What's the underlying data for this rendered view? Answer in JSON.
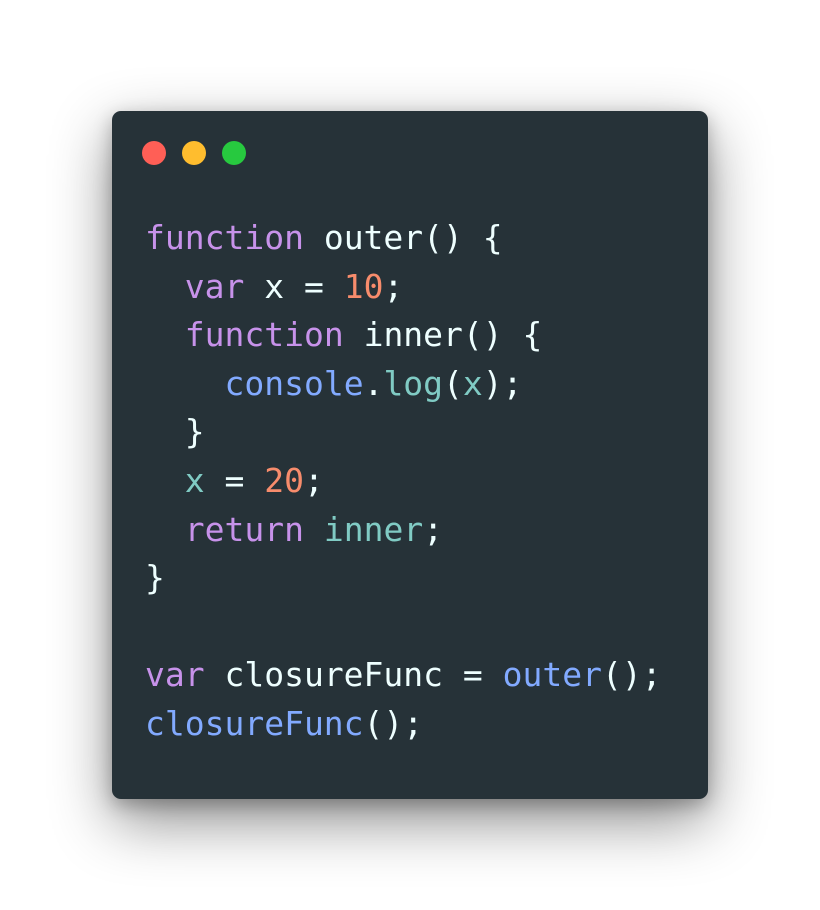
{
  "window": {
    "traffic_lights": [
      {
        "name": "close",
        "color": "#ff5f56"
      },
      {
        "name": "minimize",
        "color": "#ffbd2e"
      },
      {
        "name": "maximize",
        "color": "#27c93f"
      }
    ]
  },
  "theme": {
    "background": "#263238",
    "default": "#eeffff",
    "keyword": "#c792ea",
    "number": "#f78c6c",
    "function": "#82aaff",
    "variable": "#89ddff",
    "identifier": "#80cbc4"
  },
  "code": {
    "language": "javascript",
    "lines": [
      [
        {
          "t": "function",
          "k": "keyword"
        },
        {
          "t": " outer() {",
          "k": "default"
        }
      ],
      [
        {
          "t": "  ",
          "k": "default"
        },
        {
          "t": "var",
          "k": "keyword"
        },
        {
          "t": " x = ",
          "k": "default"
        },
        {
          "t": "10",
          "k": "number"
        },
        {
          "t": ";",
          "k": "default"
        }
      ],
      [
        {
          "t": "  ",
          "k": "default"
        },
        {
          "t": "function",
          "k": "keyword"
        },
        {
          "t": " inner() {",
          "k": "default"
        }
      ],
      [
        {
          "t": "    ",
          "k": "default"
        },
        {
          "t": "console",
          "k": "function"
        },
        {
          "t": ".",
          "k": "default"
        },
        {
          "t": "log",
          "k": "identifier"
        },
        {
          "t": "(",
          "k": "default"
        },
        {
          "t": "x",
          "k": "identifier"
        },
        {
          "t": ");",
          "k": "default"
        }
      ],
      [
        {
          "t": "  }",
          "k": "default"
        }
      ],
      [
        {
          "t": "  ",
          "k": "default"
        },
        {
          "t": "x",
          "k": "identifier"
        },
        {
          "t": " = ",
          "k": "default"
        },
        {
          "t": "20",
          "k": "number"
        },
        {
          "t": ";",
          "k": "default"
        }
      ],
      [
        {
          "t": "  ",
          "k": "default"
        },
        {
          "t": "return",
          "k": "keyword"
        },
        {
          "t": " ",
          "k": "default"
        },
        {
          "t": "inner",
          "k": "identifier"
        },
        {
          "t": ";",
          "k": "default"
        }
      ],
      [
        {
          "t": "}",
          "k": "default"
        }
      ],
      [
        {
          "t": "",
          "k": "default"
        }
      ],
      [
        {
          "t": "var",
          "k": "keyword"
        },
        {
          "t": " closureFunc = ",
          "k": "default"
        },
        {
          "t": "outer",
          "k": "function"
        },
        {
          "t": "();",
          "k": "default"
        }
      ],
      [
        {
          "t": "closureFunc",
          "k": "function"
        },
        {
          "t": "();",
          "k": "default"
        }
      ]
    ]
  }
}
